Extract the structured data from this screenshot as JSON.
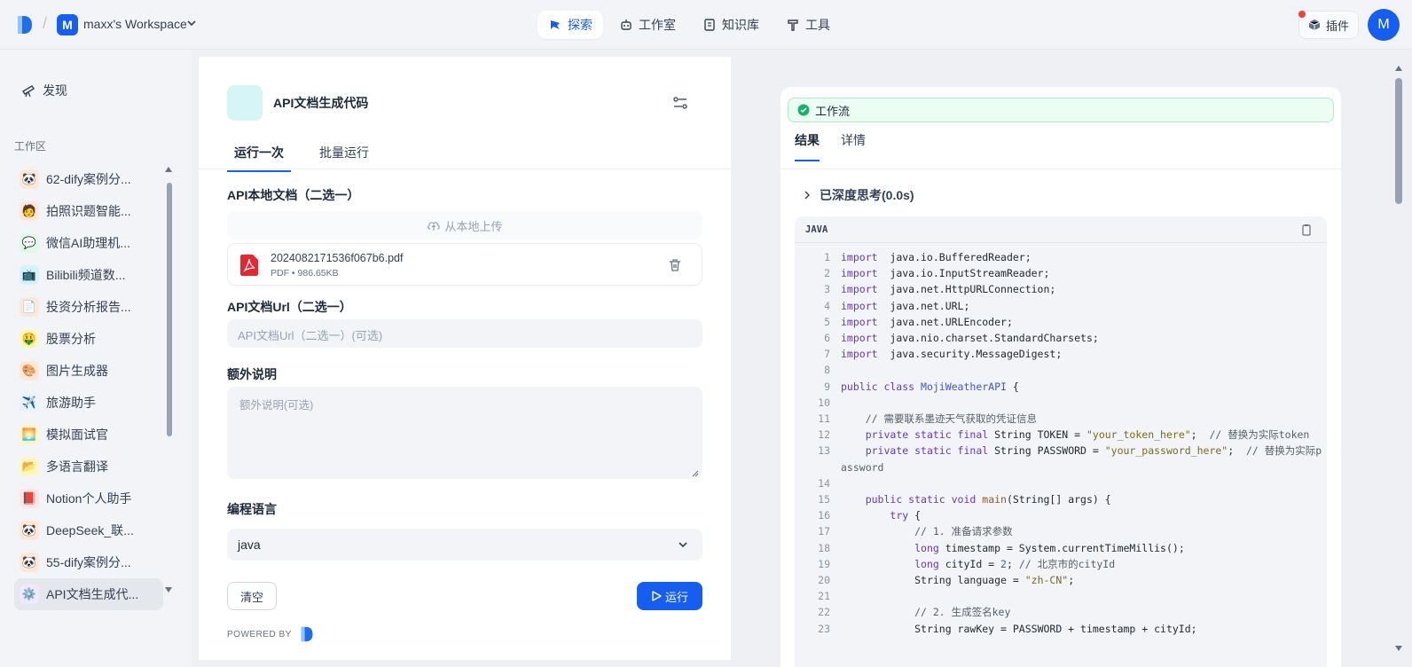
{
  "topbar": {
    "workspace_initial": "M",
    "workspace_name": "maxx's Workspace",
    "nav": [
      {
        "label": "探索",
        "icon": "explore-icon",
        "active": true
      },
      {
        "label": "工作室",
        "icon": "robot-icon",
        "active": false
      },
      {
        "label": "知识库",
        "icon": "book-icon",
        "active": false
      },
      {
        "label": "工具",
        "icon": "hammer-icon",
        "active": false
      }
    ],
    "plugin_label": "插件",
    "user_initial": "M"
  },
  "sidebar": {
    "discover_label": "发现",
    "workspace_section": "工作区",
    "items": [
      {
        "label": "62-dify案例分...",
        "icon": "panda-emoji"
      },
      {
        "label": "拍照识题智能...",
        "icon": "student-emoji"
      },
      {
        "label": "微信AI助理机...",
        "icon": "chat-emoji"
      },
      {
        "label": "Bilibili频道数...",
        "icon": "bilibili-emoji"
      },
      {
        "label": "投资分析报告...",
        "icon": "document-emoji"
      },
      {
        "label": "股票分析",
        "icon": "money-face-emoji"
      },
      {
        "label": "图片生成器",
        "icon": "palette-emoji"
      },
      {
        "label": "旅游助手",
        "icon": "airplane-emoji"
      },
      {
        "label": "模拟面试官",
        "icon": "sunrise-emoji"
      },
      {
        "label": "多语言翻译",
        "icon": "folder-emoji"
      },
      {
        "label": "Notion个人助手",
        "icon": "red-book-emoji"
      },
      {
        "label": "DeepSeek_联...",
        "icon": "panda-emoji"
      },
      {
        "label": "55-dify案例分...",
        "icon": "panda-emoji"
      },
      {
        "label": "API文档生成代...",
        "icon": "gear-emoji",
        "active": true
      }
    ]
  },
  "form": {
    "app_title": "API文档生成代码",
    "tabs": [
      "运行一次",
      "批量运行"
    ],
    "field1_label": "API本地文档（二选一）",
    "upload_label": "从本地上传",
    "file_name": "2024082171536f067b6.pdf",
    "file_meta": "PDF • 986.65KB",
    "field2_label": "API文档Url（二选一）",
    "field2_placeholder": "API文档Url（二选一）(可选)",
    "field3_label": "额外说明",
    "field3_placeholder": "额外说明(可选)",
    "field4_label": "编程语言",
    "field4_value": "java",
    "clear_label": "清空",
    "run_label": "运行",
    "powered_by": "POWERED BY"
  },
  "result": {
    "workflow_label": "工作流",
    "tabs": [
      "结果",
      "详情"
    ],
    "thinking_label": "已深度思考(0.0s)",
    "code_lang": "JAVA",
    "code_lines": [
      {
        "n": "1",
        "segs": [
          [
            "kw",
            "import"
          ],
          [
            "",
            "  java.io.BufferedReader;"
          ]
        ]
      },
      {
        "n": "2",
        "segs": [
          [
            "kw",
            "import"
          ],
          [
            "",
            "  java.io.InputStreamReader;"
          ]
        ]
      },
      {
        "n": "3",
        "segs": [
          [
            "kw",
            "import"
          ],
          [
            "",
            "  java.net.HttpURLConnection;"
          ]
        ]
      },
      {
        "n": "4",
        "segs": [
          [
            "kw",
            "import"
          ],
          [
            "",
            "  java.net.URL;"
          ]
        ]
      },
      {
        "n": "5",
        "segs": [
          [
            "kw",
            "import"
          ],
          [
            "",
            "  java.net.URLEncoder;"
          ]
        ]
      },
      {
        "n": "6",
        "segs": [
          [
            "kw",
            "import"
          ],
          [
            "",
            "  java.nio.charset.StandardCharsets;"
          ]
        ]
      },
      {
        "n": "7",
        "segs": [
          [
            "kw",
            "import"
          ],
          [
            "",
            "  java.security.MessageDigest;"
          ]
        ]
      },
      {
        "n": "8",
        "segs": []
      },
      {
        "n": "9",
        "segs": [
          [
            "kw",
            "public class "
          ],
          [
            "cls",
            "MojiWeatherAPI"
          ],
          [
            "",
            " {"
          ]
        ]
      },
      {
        "n": "10",
        "segs": []
      },
      {
        "n": "11",
        "segs": [
          [
            "cm",
            "    // 需要联系墨迹天气获取的凭证信息"
          ]
        ]
      },
      {
        "n": "12",
        "segs": [
          [
            "kw",
            "    private static final "
          ],
          [
            "",
            "String TOKEN = "
          ],
          [
            "str",
            "\"your_token_here\""
          ],
          [
            "",
            ";  "
          ],
          [
            "cm",
            "// 替换为实际token"
          ]
        ]
      },
      {
        "n": "13",
        "segs": [
          [
            "kw",
            "    private static final "
          ],
          [
            "",
            "String PASSWORD = "
          ],
          [
            "str",
            "\"your_password_here\""
          ],
          [
            "",
            ";  "
          ],
          [
            "cm",
            "// 替换为实际password"
          ]
        ]
      },
      {
        "n": "14",
        "segs": []
      },
      {
        "n": "15",
        "segs": [
          [
            "kw",
            "    public static void "
          ],
          [
            "fn",
            "main"
          ],
          [
            "",
            "(String[] args) {"
          ]
        ]
      },
      {
        "n": "16",
        "segs": [
          [
            "kw",
            "        try"
          ],
          [
            "",
            " {"
          ]
        ]
      },
      {
        "n": "17",
        "segs": [
          [
            "cm",
            "            // 1. 准备请求参数"
          ]
        ]
      },
      {
        "n": "18",
        "segs": [
          [
            "kw",
            "            long"
          ],
          [
            "",
            " timestamp = System.currentTimeMillis();"
          ]
        ]
      },
      {
        "n": "19",
        "segs": [
          [
            "kw",
            "            long"
          ],
          [
            "",
            " cityId = "
          ],
          [
            "cls",
            "2"
          ],
          [
            "",
            "; "
          ],
          [
            "cm",
            "// 北京市的cityId"
          ]
        ]
      },
      {
        "n": "20",
        "segs": [
          [
            "",
            "            String language = "
          ],
          [
            "str",
            "\"zh-CN\""
          ],
          [
            "",
            ";"
          ]
        ]
      },
      {
        "n": "21",
        "segs": []
      },
      {
        "n": "22",
        "segs": [
          [
            "cm",
            "            // 2. 生成签名key"
          ]
        ]
      },
      {
        "n": "23",
        "segs": [
          [
            "",
            "            String rawKey = PASSWORD + timestamp + cityId;"
          ]
        ]
      }
    ]
  }
}
